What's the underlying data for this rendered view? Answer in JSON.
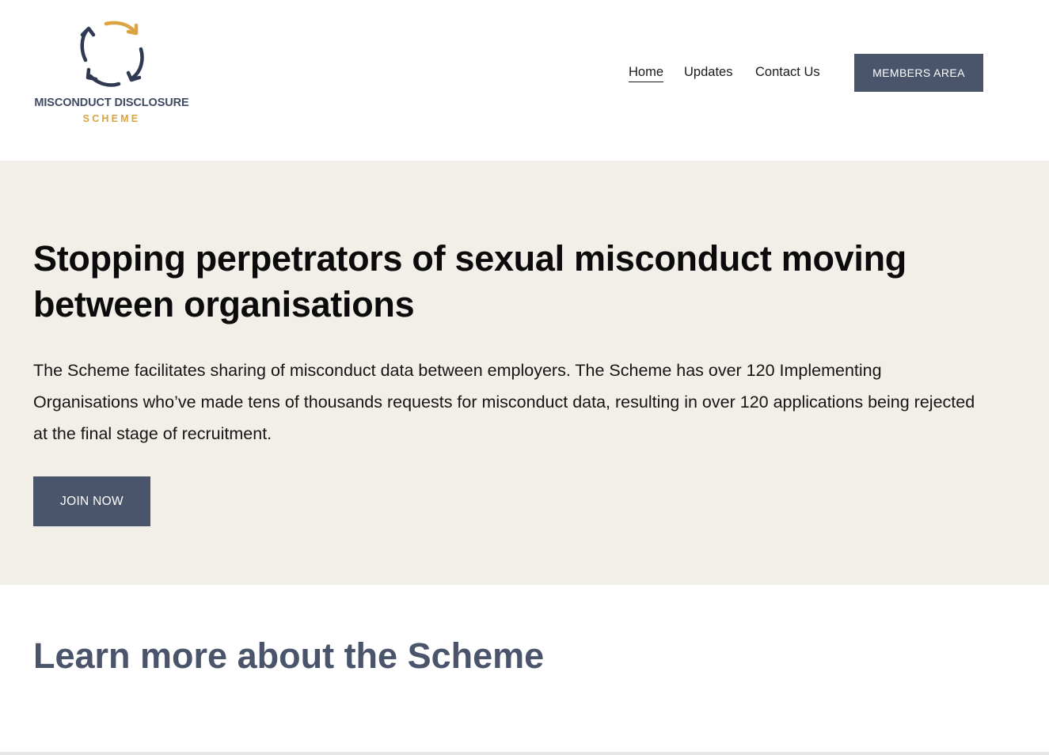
{
  "logo": {
    "title": "MISCONDUCT DISCLOSURE",
    "subtitle": "SCHEME"
  },
  "nav": {
    "items": [
      {
        "label": "Home",
        "active": true
      },
      {
        "label": "Updates",
        "active": false
      },
      {
        "label": "Contact Us",
        "active": false
      }
    ],
    "members_button": "MEMBERS AREA"
  },
  "hero": {
    "title": "Stopping perpetrators of sexual misconduct moving between organisations",
    "text": "The Scheme facilitates sharing of misconduct data between employers. The Scheme has over 120 Implementing Organisations who’ve made tens of thousands requests for misconduct data, resulting in over 120 applications being rejected at the final stage of recruitment.",
    "button": "JOIN NOW"
  },
  "learn": {
    "title": "Learn more about the Scheme"
  },
  "colors": {
    "accent_navy": "#4a546b",
    "accent_gold": "#d9a441",
    "hero_background": "#f2eee8"
  }
}
